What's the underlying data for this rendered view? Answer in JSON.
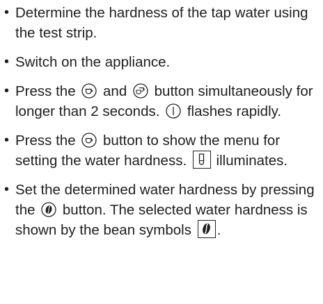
{
  "steps": [
    {
      "text": "Determine the hardness of the tap water using the test strip."
    },
    {
      "text": "Switch on the appliance."
    },
    {
      "part1": "Press the",
      "part2": "and",
      "part3": "button simultaneously for longer than 2 seconds.",
      "part4": "flashes rapidly.",
      "icons": [
        "cup-button-icon",
        "double-cup-button-icon",
        "power-icon"
      ]
    },
    {
      "part1": "Press the",
      "part2": "button to show the menu for setting the water hardness.",
      "part3": "illuminates.",
      "icons": [
        "cup-button-icon",
        "water-hardness-indicator-icon"
      ]
    },
    {
      "part1": "Set the determined water hardness by pressing the",
      "part2": "button. The selected water hardness is shown by the bean symbols",
      "part3": ".",
      "icons": [
        "bean-button-icon",
        "bean-symbol-icon"
      ]
    }
  ],
  "bullet": "•"
}
